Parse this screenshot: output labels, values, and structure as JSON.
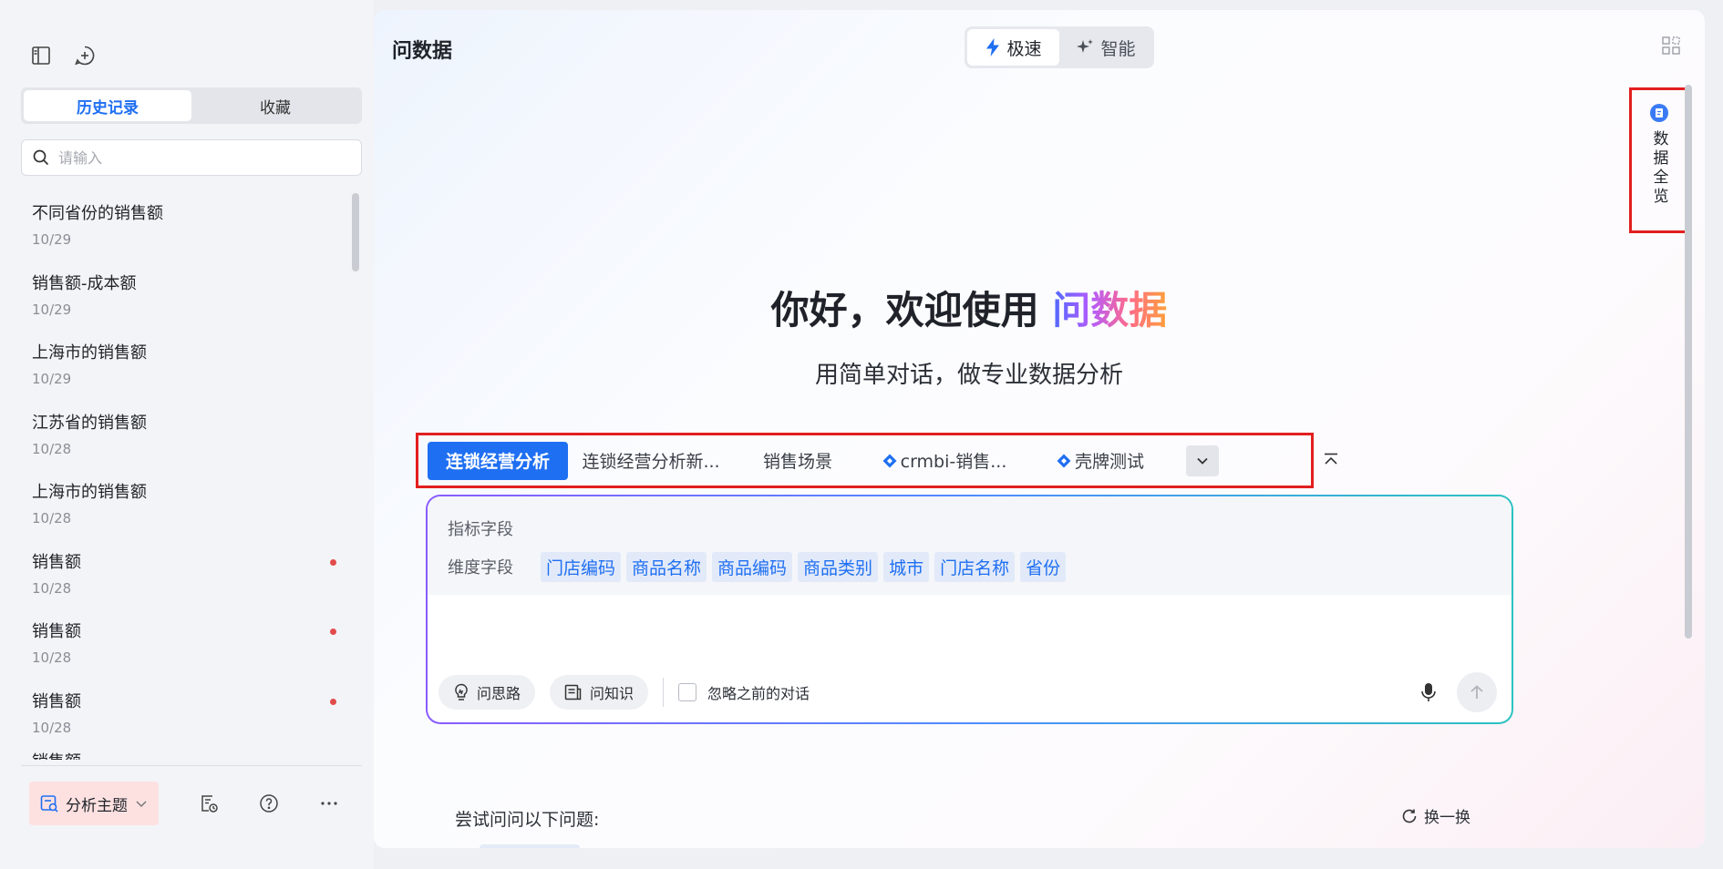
{
  "sidebar": {
    "tabs": [
      {
        "label": "历史记录",
        "active": true
      },
      {
        "label": "收藏",
        "active": false
      }
    ],
    "search": {
      "placeholder": "请输入"
    },
    "history": [
      {
        "title": "不同省份的销售额",
        "date": "10/29",
        "unread": false
      },
      {
        "title": "销售额-成本额",
        "date": "10/29",
        "unread": false
      },
      {
        "title": "上海市的销售额",
        "date": "10/29",
        "unread": false
      },
      {
        "title": "江苏省的销售额",
        "date": "10/28",
        "unread": false
      },
      {
        "title": "上海市的销售额",
        "date": "10/28",
        "unread": false
      },
      {
        "title": "销售额",
        "date": "10/28",
        "unread": true
      },
      {
        "title": "销售额",
        "date": "10/28",
        "unread": true
      },
      {
        "title": "销售额",
        "date": "10/28",
        "unread": true
      }
    ],
    "history_cut_item": "销售额",
    "bottom": {
      "theme_label": "分析主题"
    }
  },
  "main": {
    "title": "问数据",
    "modes": [
      {
        "label": "极速",
        "icon": "lightning-icon",
        "active": true
      },
      {
        "label": "智能",
        "icon": "sparkle-icon",
        "active": false
      }
    ],
    "overview_label": "数据全览",
    "hero_prefix": "你好，欢迎使用 ",
    "hero_brand": "问数据",
    "subtitle": "用简单对话，做专业数据分析",
    "topics": [
      {
        "label": "连锁经营分析",
        "active": true,
        "icon": false
      },
      {
        "label": "连锁经营分析新...",
        "active": false,
        "icon": false
      },
      {
        "label": "销售场景",
        "active": false,
        "icon": false
      },
      {
        "label": "crmbi-销售...",
        "active": false,
        "icon": true
      },
      {
        "label": "壳牌测试",
        "active": false,
        "icon": true
      }
    ],
    "fields": {
      "metric_label": "指标字段",
      "dimension_label": "维度字段",
      "dimensions": [
        "门店编码",
        "商品名称",
        "商品编码",
        "商品类别",
        "城市",
        "门店名称",
        "省份"
      ]
    },
    "tools": {
      "idea": "问思路",
      "knowledge": "问知识",
      "ignore": "忽略之前的对话"
    },
    "try_label": "尝试问问以下问题:",
    "refresh_label": "换一换"
  },
  "colors": {
    "accent": "#1f6ff2",
    "highlight_border": "#e21f1f",
    "unread_dot": "#e24b4b"
  }
}
